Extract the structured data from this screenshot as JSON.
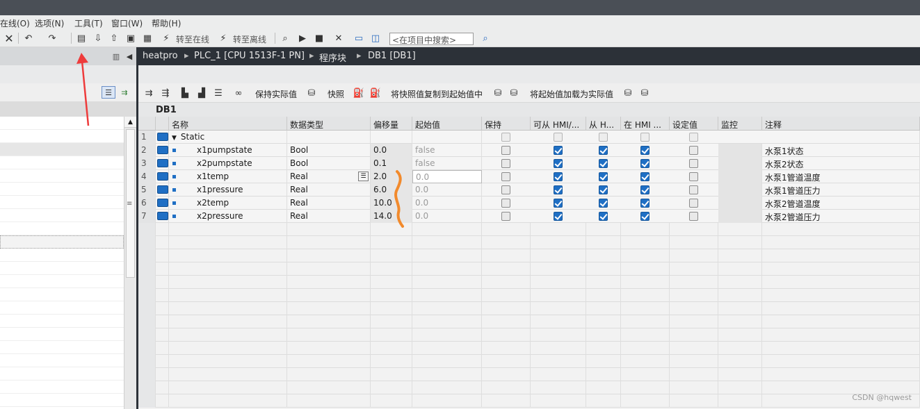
{
  "menu": {
    "items": [
      "在线(O)",
      "选项(N)",
      "工具(T)",
      "窗口(W)",
      "帮助(H)"
    ]
  },
  "toolbar": {
    "go_online": "转至在线",
    "go_offline": "转至离线",
    "search_placeholder": "<在项目中搜索>"
  },
  "breadcrumb": {
    "items": [
      "heatpro",
      "PLC_1 [CPU 1513F-1 PN]",
      "程序块",
      "DB1 [DB1]"
    ]
  },
  "editor_toolbar": {
    "keep_actual": "保持实际值",
    "snapshot": "快照",
    "copy_snapshot": "将快照值复制到起始值中",
    "load_start": "将起始值加载为实际值"
  },
  "db_title": "DB1",
  "columns": [
    "名称",
    "数据类型",
    "偏移量",
    "起始值",
    "保持",
    "可从 HMI/...",
    "从 H...",
    "在 HMI ...",
    "设定值",
    "监控",
    "注释"
  ],
  "rows": [
    {
      "num": "1",
      "name": "Static",
      "type": "",
      "offset": "",
      "start": "",
      "retain": false,
      "hmi_access": false,
      "hmi_write": false,
      "hmi_visible": false,
      "setpoint": false,
      "comment": ""
    },
    {
      "num": "2",
      "name": "x1pumpstate",
      "type": "Bool",
      "offset": "0.0",
      "start": "false",
      "retain": false,
      "hmi_access": true,
      "hmi_write": true,
      "hmi_visible": true,
      "setpoint": false,
      "comment": "水泵1状态"
    },
    {
      "num": "3",
      "name": "x2pumpstate",
      "type": "Bool",
      "offset": "0.1",
      "start": "false",
      "retain": false,
      "hmi_access": true,
      "hmi_write": true,
      "hmi_visible": true,
      "setpoint": false,
      "comment": "水泵2状态"
    },
    {
      "num": "4",
      "name": "x1temp",
      "type": "Real",
      "offset": "2.0",
      "start": "0.0",
      "retain": false,
      "hmi_access": true,
      "hmi_write": true,
      "hmi_visible": true,
      "setpoint": false,
      "comment": "水泵1管道温度"
    },
    {
      "num": "5",
      "name": "x1pressure",
      "type": "Real",
      "offset": "6.0",
      "start": "0.0",
      "retain": false,
      "hmi_access": true,
      "hmi_write": true,
      "hmi_visible": true,
      "setpoint": false,
      "comment": "水泵1管道压力"
    },
    {
      "num": "6",
      "name": "x2temp",
      "type": "Real",
      "offset": "10.0",
      "start": "0.0",
      "retain": false,
      "hmi_access": true,
      "hmi_write": true,
      "hmi_visible": true,
      "setpoint": false,
      "comment": "水泵2管道温度"
    },
    {
      "num": "7",
      "name": "x2pressure",
      "type": "Real",
      "offset": "14.0",
      "start": "0.0",
      "retain": false,
      "hmi_access": true,
      "hmi_write": true,
      "hmi_visible": true,
      "setpoint": false,
      "comment": "水泵2管道压力"
    }
  ],
  "watermark": "CSDN @hqwest",
  "colors": {
    "accent": "#1f6fc4",
    "annotation_red": "#ee3b3b",
    "annotation_orange": "#f28a2c"
  }
}
